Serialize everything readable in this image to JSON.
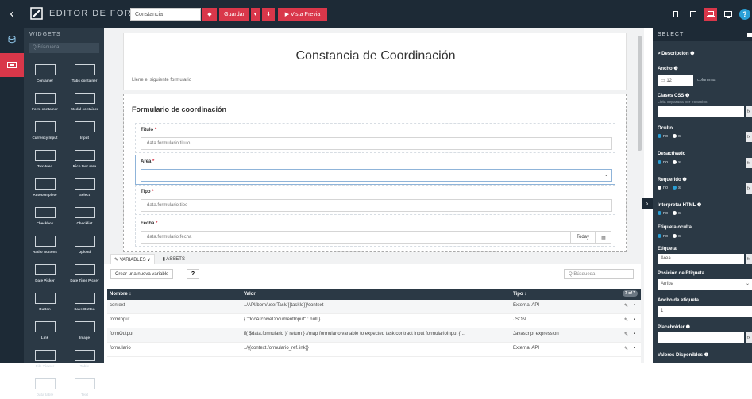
{
  "topbar": {
    "title": "EDITOR DE FORM",
    "form_name": "Constancia",
    "save_label": "Guardar",
    "preview_label": "▶ Vista Previa",
    "help": "?"
  },
  "widgets": {
    "header": "WIDGETS",
    "search_placeholder": "Q Búsqueda",
    "items": [
      {
        "label": "Container",
        "icon": "container-icon"
      },
      {
        "label": "Tabs container",
        "icon": "tabs-icon"
      },
      {
        "label": "Form container",
        "icon": "form-container-icon"
      },
      {
        "label": "Modal container",
        "icon": "modal-icon"
      },
      {
        "label": "Currency Input",
        "icon": "currency-icon"
      },
      {
        "label": "Input",
        "icon": "input-icon"
      },
      {
        "label": "TextArea",
        "icon": "textarea-icon"
      },
      {
        "label": "Rich text area",
        "icon": "richtext-icon"
      },
      {
        "label": "Autocomplete",
        "icon": "autocomplete-icon"
      },
      {
        "label": "Select",
        "icon": "select-icon"
      },
      {
        "label": "Checkbox",
        "icon": "checkbox-icon"
      },
      {
        "label": "Checklist",
        "icon": "checklist-icon"
      },
      {
        "label": "Radio Buttons",
        "icon": "radio-icon"
      },
      {
        "label": "Upload",
        "icon": "upload-icon"
      },
      {
        "label": "Date Picker",
        "icon": "date-icon"
      },
      {
        "label": "Date Time Picker",
        "icon": "datetime-icon"
      },
      {
        "label": "Button",
        "icon": "button-icon"
      },
      {
        "label": "Save Button",
        "icon": "save-icon"
      },
      {
        "label": "Link",
        "icon": "link-icon"
      },
      {
        "label": "Image",
        "icon": "image-icon"
      },
      {
        "label": "File Viewer",
        "icon": "file-viewer-icon"
      },
      {
        "label": "Table",
        "icon": "table-icon"
      },
      {
        "label": "Data table",
        "icon": "datatable-icon"
      },
      {
        "label": "Text",
        "icon": "text-icon"
      }
    ]
  },
  "document": {
    "title": "Constancia de Coordinación",
    "description": "Llene el siguiente formulario"
  },
  "form": {
    "title": "Formulario de coordinación",
    "fields": [
      {
        "label": "Titulo",
        "value": "data.formulario.titulo"
      },
      {
        "label": "Area",
        "value": ""
      },
      {
        "label": "Tipo",
        "value": "data.formulario.tipo"
      },
      {
        "label": "Fecha",
        "value": "data.formulario.fecha",
        "today": "Today"
      }
    ]
  },
  "variables": {
    "tab_variables": "✎ VARIABLES ∨",
    "tab_assets": "▮ ASSETS",
    "new_button": "Crear una nueva variable",
    "search_placeholder": "Q Búsqueda",
    "count": "7 of 7",
    "columns": [
      "Nombre ↕",
      "Valor",
      "Tipo ↕"
    ],
    "rows": [
      {
        "name": "context",
        "value": "../API/bpm/userTask/{{taskId}}/context",
        "type": "External API"
      },
      {
        "name": "formInput",
        "value": "{ \"docArchiveDocumentInput\" : null }",
        "type": "JSON"
      },
      {
        "name": "formOutput",
        "value": "if( $data.formulario ){ return } //map formulario variable to expected task contract input formularioInput { ...",
        "type": "Javascript expression"
      },
      {
        "name": "formulario",
        "value": "../{{context.formulario_ref.link}}",
        "type": "External API"
      }
    ]
  },
  "sidebar": {
    "header": "SELECT",
    "description": "> Descripción ❶",
    "width_label": "Ancho ❶",
    "width_value": "12",
    "width_unit": "columnas",
    "css_label": "Clases CSS ❶",
    "css_sub": "Lista separada por espacios",
    "hidden_label": "Oculto",
    "disabled_label": "Desactivado",
    "required_label": "Requerido ❶",
    "html_label": "Interpretar HTML ❶",
    "hidden_tag_label": "Etiqueta oculta",
    "tag_label": "Etiqueta",
    "tag_value": "Area",
    "tag_pos_label": "Posición de Etiqueta",
    "tag_pos_value": "Arriba",
    "tag_width_label": "Ancho de etiqueta",
    "tag_width_value": "1",
    "placeholder_label": "Placeholder ❶",
    "available_label": "Valores Disponibles ❶",
    "no": "no",
    "yes": "si",
    "fx": "fx"
  }
}
